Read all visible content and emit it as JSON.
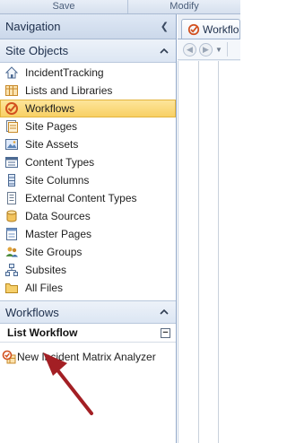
{
  "ribbon": {
    "groups": [
      "Save",
      "Modify"
    ]
  },
  "navigation": {
    "title": "Navigation",
    "collapse_glyph": "❮",
    "site_objects": {
      "label": "Site Objects",
      "items": [
        {
          "label": "IncidentTracking",
          "icon": "site-home-icon"
        },
        {
          "label": "Lists and Libraries",
          "icon": "lists-libraries-icon"
        },
        {
          "label": "Workflows",
          "icon": "workflows-icon",
          "selected": true
        },
        {
          "label": "Site Pages",
          "icon": "site-pages-icon"
        },
        {
          "label": "Site Assets",
          "icon": "site-assets-icon"
        },
        {
          "label": "Content Types",
          "icon": "content-types-icon"
        },
        {
          "label": "Site Columns",
          "icon": "site-columns-icon"
        },
        {
          "label": "External Content Types",
          "icon": "external-content-types-icon"
        },
        {
          "label": "Data Sources",
          "icon": "data-sources-icon"
        },
        {
          "label": "Master Pages",
          "icon": "master-pages-icon"
        },
        {
          "label": "Site Groups",
          "icon": "site-groups-icon"
        },
        {
          "label": "Subsites",
          "icon": "subsites-icon"
        },
        {
          "label": "All Files",
          "icon": "all-files-icon"
        }
      ]
    },
    "workflows_section": {
      "label": "Workflows",
      "list_workflow": {
        "label": "List Workflow",
        "collapse_glyph": "−",
        "items": [
          {
            "label": "New Incident Matrix Analyzer",
            "icon": "list-workflow-icon"
          }
        ]
      }
    }
  },
  "document": {
    "tab_label": "Workflo",
    "toolbar": {
      "back_glyph": "◀",
      "forward_glyph": "▶",
      "dropdown_glyph": "▼"
    }
  },
  "colors": {
    "selection": "#f8d064",
    "arrow": "#a31f24"
  }
}
